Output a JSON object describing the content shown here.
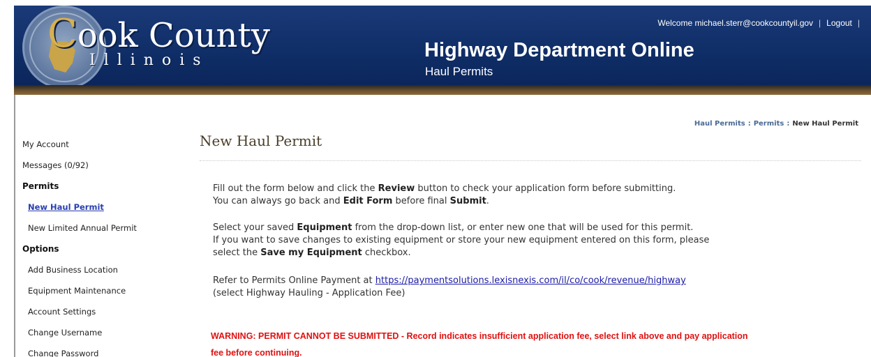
{
  "header": {
    "county_first_letter": "C",
    "county_rest": "ook County",
    "state": "Illinois",
    "welcome_text": "Welcome michael.sterr@cookcountyil.gov",
    "separator": "|",
    "logout_label": "Logout",
    "app_title": "Highway Department Online",
    "app_subtitle": "Haul Permits"
  },
  "breadcrumb": {
    "items": [
      "Haul Permits",
      "Permits",
      "New Haul Permit"
    ],
    "separator": ":"
  },
  "sidebar": {
    "items": [
      {
        "label": "My Account"
      },
      {
        "label": "Messages (0/92)"
      },
      {
        "label": "Permits"
      },
      {
        "label": "New Haul Permit"
      },
      {
        "label": "New Limited Annual Permit"
      },
      {
        "label": "Options"
      },
      {
        "label": "Add Business Location"
      },
      {
        "label": "Equipment Maintenance"
      },
      {
        "label": "Account Settings"
      },
      {
        "label": "Change Username"
      },
      {
        "label": "Change Password"
      }
    ]
  },
  "main": {
    "page_title": "New Haul Permit",
    "p1": {
      "a": "Fill out the form below and click the ",
      "b": "Review",
      "c": " button to check your application form before submitting.",
      "d": "You can always go back and ",
      "e": "Edit Form",
      "f": " before final ",
      "g": "Submit",
      "h": "."
    },
    "p2": {
      "a": "Select your saved ",
      "b": "Equipment",
      "c": " from the drop-down list, or enter new one that will be used for this permit.",
      "d": "If you want to save changes to existing equipment or store your new equipment entered on this form, please",
      "e": "select the ",
      "f": "Save my Equipment",
      "g": " checkbox."
    },
    "p3": {
      "a": "Refer to Permits Online Payment at ",
      "link": "https://paymentsolutions.lexisnexis.com/il/co/cook/revenue/highway",
      "b": "(select Highway Hauling - Application Fee)"
    },
    "warning_line1": "WARNING: PERMIT CANNOT BE SUBMITTED - Record indicates insufficient application fee, select link above and pay application",
    "warning_line2": "fee before continuing."
  },
  "colors": {
    "banner": "#0f2d66",
    "warning": "#e01010",
    "link": "#1a1aa6",
    "active_nav": "#2a3fb0"
  }
}
